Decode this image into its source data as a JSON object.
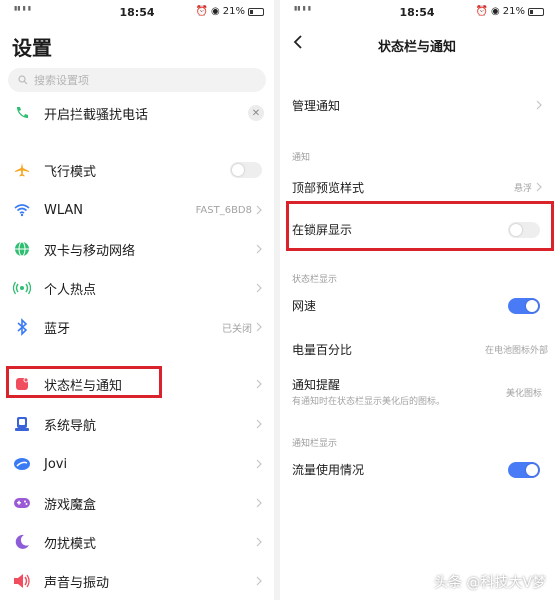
{
  "left_screen": {
    "status_bar": {
      "time": "18:54",
      "battery": "21%"
    },
    "title": "设置",
    "search": {
      "placeholder": "搜索设置项"
    },
    "items": [
      {
        "label": "开启拦截骚扰电话",
        "icon": "phone-icon"
      },
      {
        "label": "飞行模式",
        "icon": "airplane-icon"
      },
      {
        "label": "WLAN",
        "value": "FAST_6BD8",
        "icon": "wifi-icon"
      },
      {
        "label": "双卡与移动网络",
        "icon": "globe-icon"
      },
      {
        "label": "个人热点",
        "icon": "hotspot-icon"
      },
      {
        "label": "蓝牙",
        "value": "已关闭",
        "icon": "bluetooth-icon"
      },
      {
        "label": "状态栏与通知",
        "icon": "notification-icon"
      },
      {
        "label": "系统导航",
        "icon": "navigation-icon"
      },
      {
        "label": "Jovi",
        "icon": "jovi-icon"
      },
      {
        "label": "游戏魔盒",
        "icon": "gamepad-icon"
      },
      {
        "label": "勿扰模式",
        "icon": "moon-icon"
      },
      {
        "label": "声音与振动",
        "icon": "speaker-icon"
      }
    ]
  },
  "right_screen": {
    "status_bar": {
      "time": "18:54",
      "battery": "21%"
    },
    "title": "状态栏与通知",
    "manage": {
      "label": "管理通知"
    },
    "section_notification": "通知",
    "top_preview": {
      "label": "顶部预览样式",
      "value": "悬浮"
    },
    "lock_screen": {
      "label": "在锁屏显示",
      "on": false
    },
    "section_statusbar": "状态栏显示",
    "network_speed": {
      "label": "网速",
      "on": true
    },
    "battery_percent": {
      "label": "电量百分比",
      "value": "在电池图标外部"
    },
    "notify_hint": {
      "label": "通知提醒",
      "sub": "有通知时在状态栏显示美化后的图标。",
      "value": "美化图标"
    },
    "section_drawer": "通知栏显示",
    "data_usage": {
      "label": "流量使用情况",
      "on": true
    }
  },
  "watermark": "头条 @科技大V梦",
  "colors": {
    "accent_blue": "#4a7bf7",
    "highlight_red": "#d9222a"
  }
}
